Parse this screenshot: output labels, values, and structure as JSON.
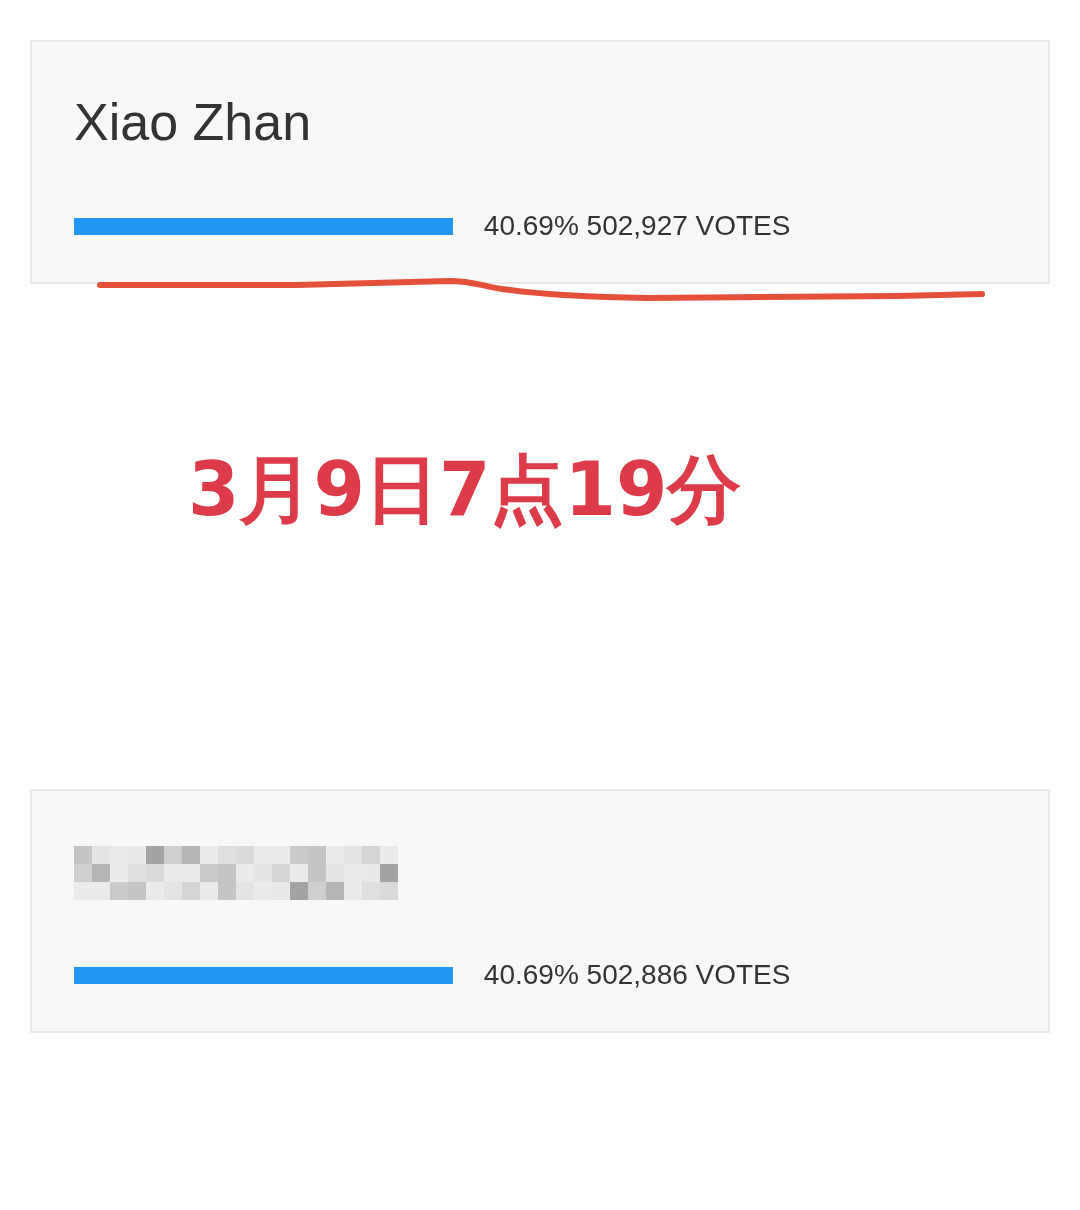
{
  "cards": [
    {
      "name": "Xiao Zhan",
      "name_hidden": false,
      "level": 0.4069,
      "result": "40.69% 502,927 VOTES",
      "underlined": true
    },
    {
      "name_hidden": true,
      "level": 0.4069,
      "result": "40.69% 502,886 VOTES",
      "underlined": false
    }
  ],
  "annotation": {
    "text": "3月9日7点19分"
  }
}
